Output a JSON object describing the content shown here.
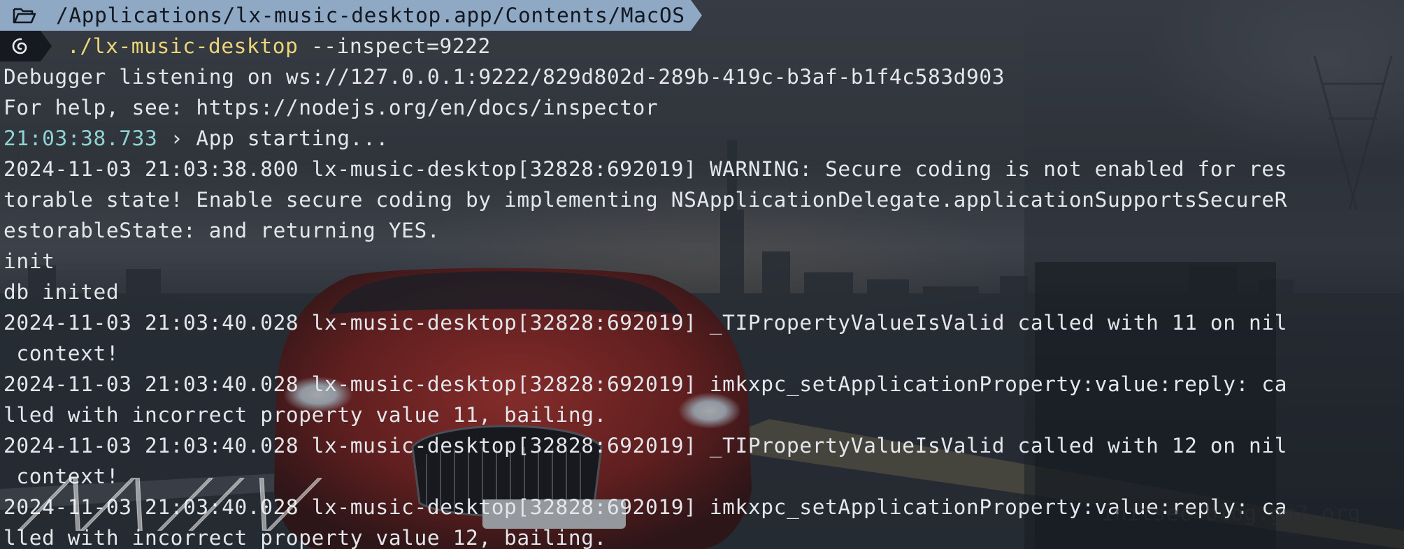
{
  "prompt": {
    "path": "/Applications/lx-music-desktop.app/Contents/MacOS",
    "command": "./lx-music-desktop",
    "args": " --inspect=9222"
  },
  "output": [
    "Debugger listening on ws://127.0.0.1:9222/829d802d-289b-419c-b3af-b1f4c583d903",
    "For help, see: https://nodejs.org/en/docs/inspector",
    {
      "timestamp": "21:03:38.733",
      "text": " › App starting..."
    },
    "2024-11-03 21:03:38.800 lx-music-desktop[32828:692019] WARNING: Secure coding is not enabled for res",
    "torable state! Enable secure coding by implementing NSApplicationDelegate.applicationSupportsSecureR",
    "estorableState: and returning YES.",
    "init",
    "db inited",
    "2024-11-03 21:03:40.028 lx-music-desktop[32828:692019] _TIPropertyValueIsValid called with 11 on nil",
    " context!",
    "2024-11-03 21:03:40.028 lx-music-desktop[32828:692019] imkxpc_setApplicationProperty:value:reply: ca",
    "lled with incorrect property value 11, bailing.",
    "2024-11-03 21:03:40.028 lx-music-desktop[32828:692019] _TIPropertyValueIsValid called with 12 on nil",
    " context!",
    "2024-11-03 21:03:40.028 lx-music-desktop[32828:692019] imkxpc_setApplicationProperty:value:reply: ca",
    "lled with incorrect property value 12, bailing."
  ],
  "watermarks": {
    "left": "╱╲╱╲ ╱╱ ╲╱",
    "right": "initsec blog.gm7.org"
  },
  "colors": {
    "path_bg": "#8fa9c4",
    "command": "#ecd67a",
    "timestamp": "#8fd3d3",
    "text": "#e3e6ea"
  },
  "icons": [
    "folder-open-icon",
    "debian-swirl-icon"
  ]
}
